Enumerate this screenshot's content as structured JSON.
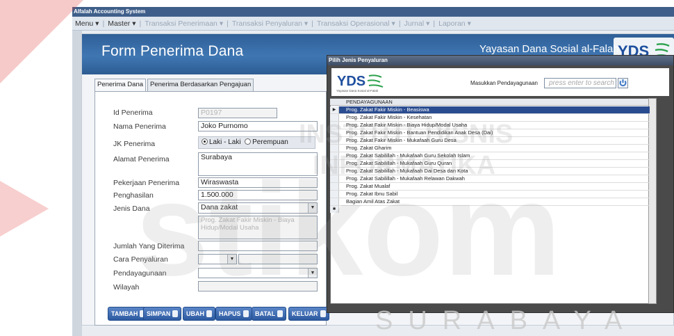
{
  "window": {
    "title": "Alfalah Accounting System"
  },
  "menu": [
    {
      "label": "Menu",
      "state": "active"
    },
    {
      "label": "Master",
      "state": "active"
    },
    {
      "label": "Transaksi Penerimaan",
      "state": "disabled"
    },
    {
      "label": "Transaksi Penyaluran",
      "state": "disabled"
    },
    {
      "label": "Transaksi Operasional",
      "state": "disabled"
    },
    {
      "label": "Jurnal",
      "state": "disabled"
    },
    {
      "label": "Laporan",
      "state": "disabled"
    }
  ],
  "form": {
    "title": "Form Penerima Dana",
    "org_name": "Yayasan Dana Sosial al-Falah",
    "logo_text": "YDSF",
    "tabs": [
      "Penerima Dana",
      "Penerima Berdasarkan Pengajuan"
    ],
    "labels": {
      "id": "Id Penerima",
      "nama": "Nama Penerima",
      "jk": "JK Penerima",
      "alamat": "Alamat Penerima",
      "pekerjaan": "Pekerjaan Penerima",
      "penghasilan": "Penghasilan",
      "jenis_dana": "Jenis Dana",
      "jumlah": "Jumlah Yang Diterima",
      "cara": "Cara Penyaluran",
      "pendayagunaan": "Pendayagunaan",
      "wilayah": "Wilayah"
    },
    "values": {
      "id": "P0197",
      "nama": "Joko Purnomo",
      "jk_options": [
        "Laki - Laki",
        "Perempuan"
      ],
      "jk_selected": "Laki - Laki",
      "alamat": "Surabaya",
      "pekerjaan": "Wiraswasta",
      "penghasilan": "1.500.000",
      "jenis_dana": "Dana zakat",
      "jenis_dana_detail": "Prog. Zakat Fakir Miskin - Biaya Hidup/Modal Usaha",
      "jumlah": "",
      "cara": "",
      "pendayagunaan": "",
      "wilayah": ""
    },
    "buttons": [
      "TAMBAH",
      "SIMPAN",
      "UBAH",
      "HAPUS",
      "BATAL",
      "KELUAR"
    ]
  },
  "dialog": {
    "title": "Pilih Jenis Penyaluran",
    "logo_text": "YDSF",
    "logo_caption": "Yayasan Dana Sosial al-Falah",
    "search_label": "Masukkan Pendayagunaan",
    "search_placeholder": "press enter to search",
    "grid_header": "PENDAYAGUNAAN",
    "rows": [
      "Prog. Zakat Fakir Miskin - Beasiswa",
      "Prog. Zakat Fakir Miskin - Kesehatan",
      "Prog. Zakat Fakir Miskin - Biaya Hidup/Modal Usaha",
      "Prog. Zakat Fakir Miskin - Bantuan Pendidikan Anak Desa (Dai)",
      "Prog. Zakat Fakir Miskin - Mukafaah Guru Desa",
      "Prog. Zakat Gharim",
      "Prog. Zakat Sabilillah - Mukafaah Guru Sekolah Islam",
      "Prog. Zakat Sabilillah - Mukafaah Guru Quran",
      "Prog. Zakat Sabilillah - Mukafaah Dai Desa dan Kota",
      "Prog. Zakat Sabilillah - Mukafaah Relawan Dakwah",
      "Prog. Zakat Mualaf",
      "Prog. Zakat Ibnu Sabil",
      "Bagian Amil Atas Zakat"
    ],
    "selected_index": 0
  },
  "watermark": {
    "text": "SURABAYA",
    "colors": {
      "red": "#e0403d",
      "gray": "#c9c9c9"
    }
  }
}
